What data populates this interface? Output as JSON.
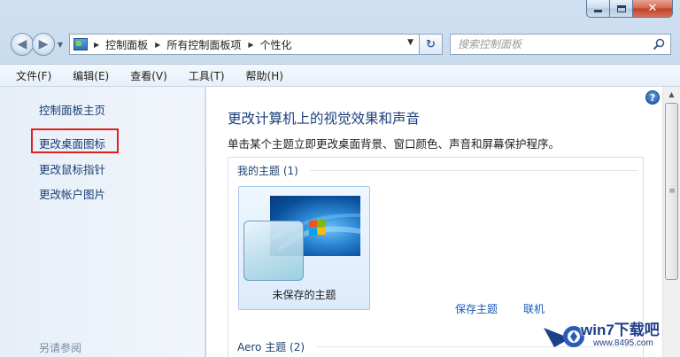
{
  "window": {
    "caption_buttons": [
      "minimize",
      "maximize",
      "close"
    ]
  },
  "address_bar": {
    "crumbs": [
      "控制面板",
      "所有控制面板项",
      "个性化"
    ],
    "icon": "control-panel-icon"
  },
  "search": {
    "placeholder": "搜索控制面板",
    "value": ""
  },
  "menubar": {
    "items": [
      "文件(F)",
      "编辑(E)",
      "查看(V)",
      "工具(T)",
      "帮助(H)"
    ]
  },
  "sidebar": {
    "items": [
      "控制面板主页",
      "更改桌面图标",
      "更改鼠标指针",
      "更改帐户图片"
    ],
    "highlighted_item": "更改桌面图标",
    "see_also": "另请参阅"
  },
  "main": {
    "title": "更改计算机上的视觉效果和声音",
    "description": "单击某个主题立即更改桌面背景、窗口颜色、声音和屏幕保护程序。",
    "my_themes_header": "我的主题 (1)",
    "theme_tile_label": "未保存的主题",
    "save_theme_link": "保存主题",
    "online_link": "联机",
    "aero_header": "Aero 主题 (2)"
  },
  "watermark": {
    "text": "win7下载吧",
    "url": "www.8495.com"
  },
  "colors": {
    "link_blue": "#1a3e72",
    "highlight_red": "#e02020",
    "title_blue": "#1a3f7a"
  }
}
